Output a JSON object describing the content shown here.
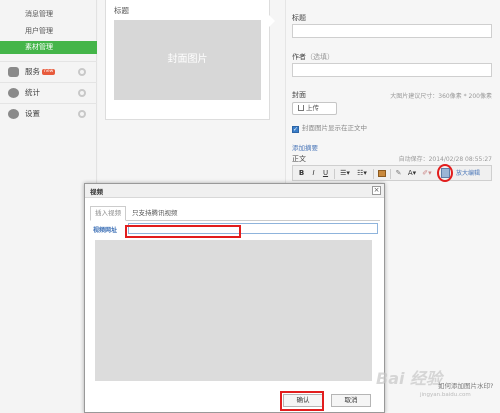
{
  "sidebar": {
    "sub_items": [
      "消息管理",
      "用户管理",
      "素材管理"
    ],
    "active_index": 2,
    "groups": [
      {
        "label": "服务",
        "badge": "new",
        "icon": "service-icon"
      },
      {
        "label": "统计",
        "icon": "stats-icon"
      },
      {
        "label": "设置",
        "icon": "settings-icon"
      }
    ]
  },
  "card": {
    "title": "标题",
    "cover_placeholder": "封面图片"
  },
  "edit": {
    "title_label": "标题",
    "author_label": "作者",
    "author_hint": "（选填）",
    "cover_label": "封面",
    "cover_size_hint": "大图片建议尺寸：360像素 * 200像素",
    "upload_label": "上传",
    "show_cover_label": "封面图片显示在正文中",
    "add_summary": "添加摘要",
    "body_label": "正文",
    "autosave": "自动保存：2014/02/28 08:55:27",
    "zoom_edit": "放大编辑"
  },
  "toolbar": {
    "bold": "B",
    "italic": "I",
    "underline": "U",
    "font_color": "A"
  },
  "dialog": {
    "title": "视频",
    "close": "×",
    "tab_insert": "插入视频",
    "tab_tencent": "只支持腾讯视频",
    "url_label": "视频网址",
    "url_value": "",
    "ok": "确认",
    "cancel": "取消"
  },
  "footer": {
    "watermark_tip": "如何添加图片水印?"
  },
  "watermark": {
    "text": "Bai 经验",
    "sub": "jingyan.baidu.com"
  },
  "colors": {
    "active_green": "#44b549",
    "highlight_red": "#e21d1d",
    "link_blue": "#4a76b8"
  }
}
